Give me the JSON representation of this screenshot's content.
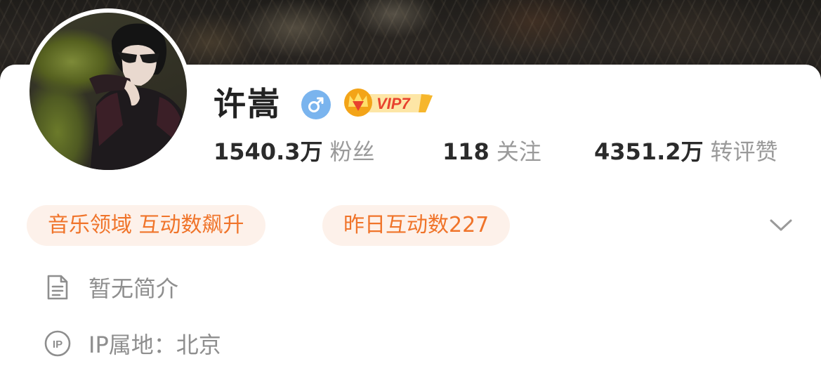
{
  "profile": {
    "name": "许嵩",
    "gender": "male",
    "vip_label": "VIP7",
    "stats": [
      {
        "value": "1540.3万",
        "label": "粉丝"
      },
      {
        "value": "118",
        "label": "关注"
      },
      {
        "value": "4351.2万",
        "label": "转评赞"
      }
    ],
    "tags": [
      {
        "label": "音乐领域 互动数飙升"
      },
      {
        "label": "昨日互动数227"
      }
    ],
    "bio": "暂无简介",
    "ip_location": "IP属地：北京"
  },
  "icons": {
    "gender": "male-icon",
    "vip": "vip-crown-icon",
    "expand": "chevron-down-icon",
    "bio": "document-icon",
    "ip": "ip-icon"
  },
  "colors": {
    "accent": "#f0742a",
    "tag_bg": "#fdf1ea",
    "gender": "#7ab4ee",
    "vip_gold": "#f3a418",
    "vip_red": "#e8422e"
  }
}
